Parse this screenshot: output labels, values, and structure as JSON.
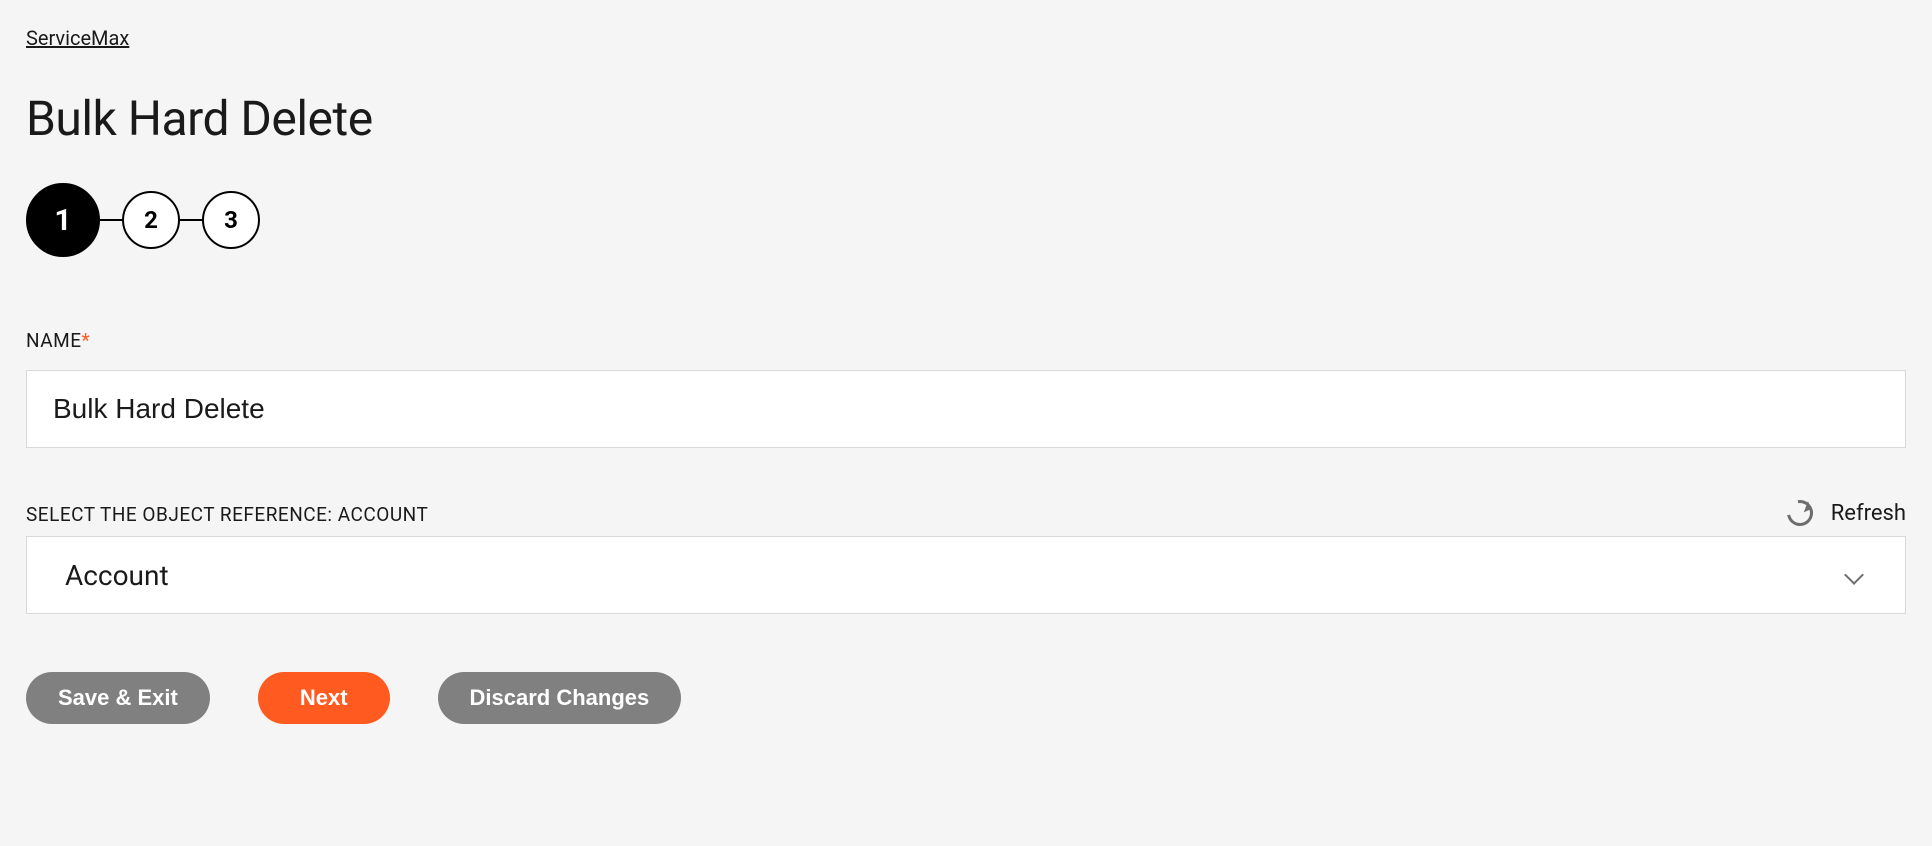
{
  "breadcrumb": {
    "root": "ServiceMax"
  },
  "page": {
    "title": "Bulk Hard Delete"
  },
  "stepper": {
    "steps": [
      "1",
      "2",
      "3"
    ],
    "current_index": 0
  },
  "form": {
    "name": {
      "label": "NAME",
      "required_mark": "*",
      "value": "Bulk Hard Delete"
    },
    "object_ref": {
      "label": "SELECT THE OBJECT REFERENCE: ACCOUNT",
      "selected": "Account",
      "refresh_label": "Refresh"
    }
  },
  "buttons": {
    "save_exit": "Save & Exit",
    "next": "Next",
    "discard": "Discard Changes"
  }
}
